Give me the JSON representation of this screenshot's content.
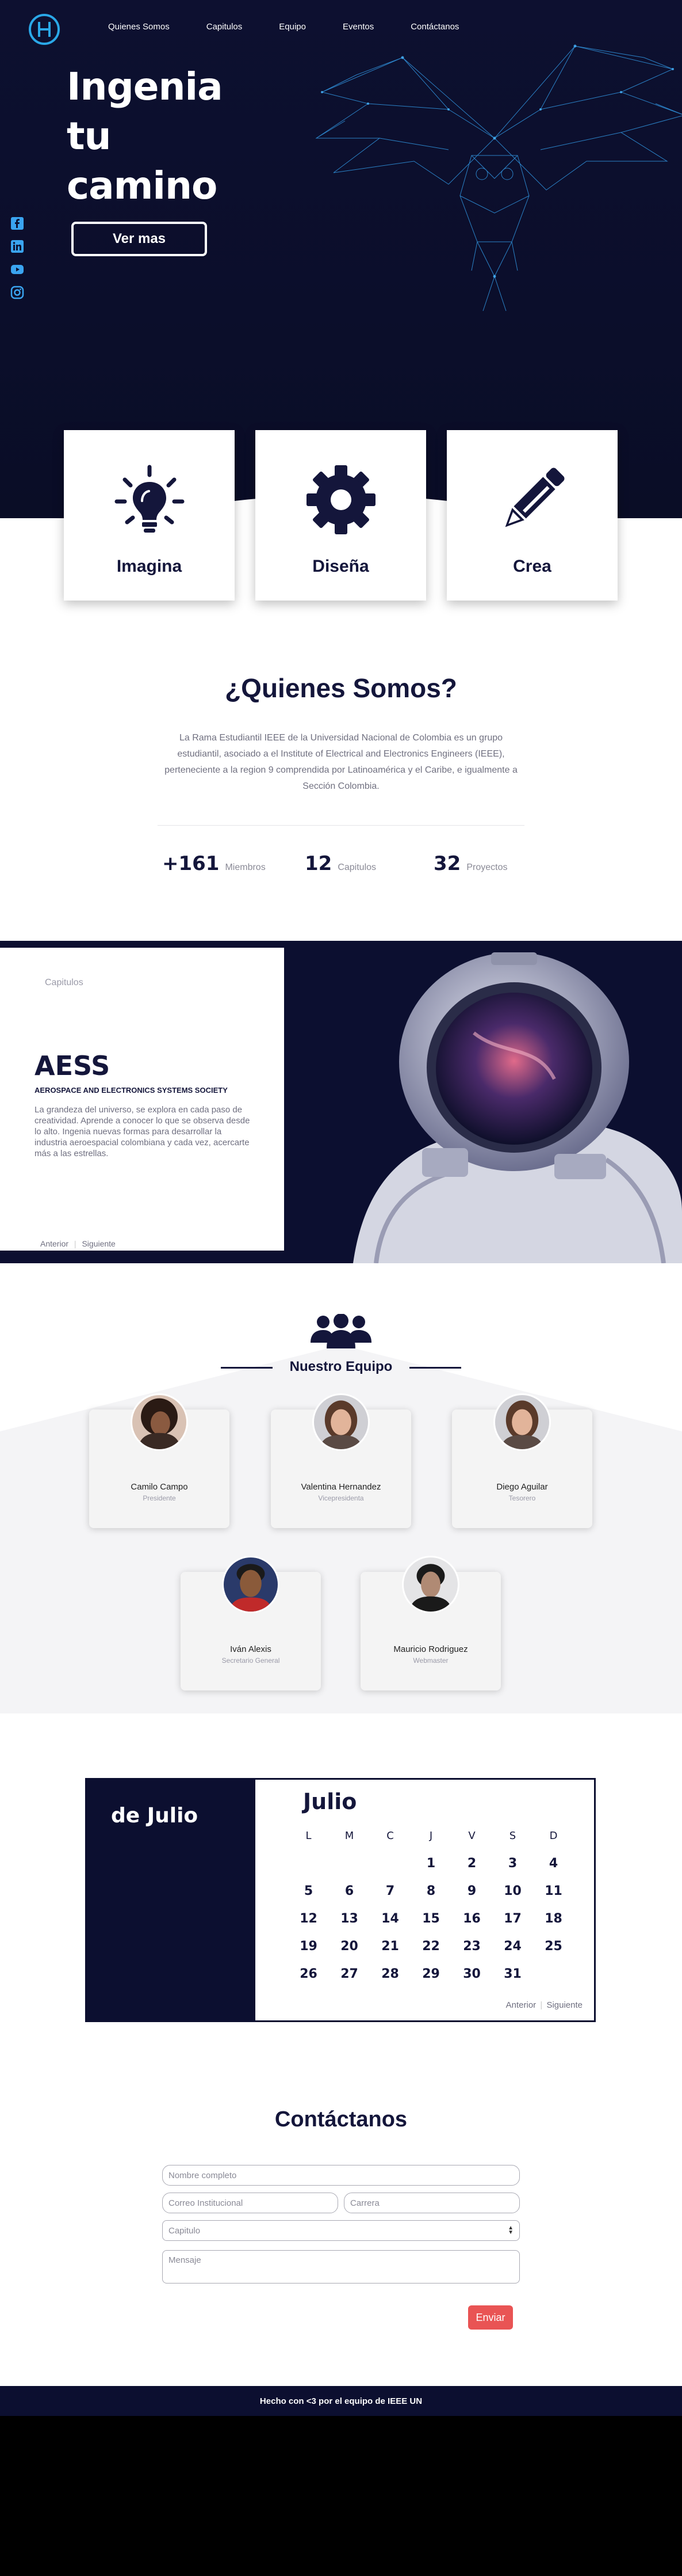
{
  "nav": {
    "items": [
      "Quienes Somos",
      "Capitulos",
      "Equipo",
      "Eventos",
      "Contáctanos"
    ]
  },
  "hero": {
    "title_lines": [
      "Ingenia",
      "tu",
      "camino"
    ],
    "button": "Ver mas"
  },
  "social": [
    "facebook-icon",
    "linkedin-icon",
    "youtube-icon",
    "instagram-icon"
  ],
  "cards": [
    {
      "label": "Imagina",
      "icon": "lightbulb-icon"
    },
    {
      "label": "Diseña",
      "icon": "gear-icon"
    },
    {
      "label": "Crea",
      "icon": "pencil-icon"
    }
  ],
  "about": {
    "title": "¿Quienes Somos?",
    "text": "La Rama Estudiantil IEEE de la Universidad Nacional de Colombia es un grupo estudiantil, asociado a el Institute of Electrical and Electronics Engineers (IEEE), perteneciente a la region 9 comprendida por Latinoamérica y el Caribe, e igualmente a Sección Colombia.",
    "stats": [
      {
        "number": "+161",
        "label": "Miembros"
      },
      {
        "number": "12",
        "label": "Capitulos"
      },
      {
        "number": "32",
        "label": "Proyectos"
      }
    ]
  },
  "chapters": {
    "label": "Capitulos",
    "name": "AESS",
    "subtitle": "AEROSPACE AND ELECTRONICS SYSTEMS SOCIETY",
    "description": "La grandeza del universo, se explora en cada paso de creatividad. Aprende a conocer lo que se observa desde lo alto. Ingenia nuevas formas para desarrollar la industria aeroespacial colombiana y cada vez, acercarte más a las estrellas.",
    "prev": "Anterior",
    "next": "Siguiente"
  },
  "team": {
    "title": "Nuestro Equipo",
    "members": [
      {
        "name": "Camilo Campo",
        "role": "Presidente"
      },
      {
        "name": "Valentina Hernandez",
        "role": "Vicepresidenta"
      },
      {
        "name": "Diego Aguilar",
        "role": "Tesorero"
      },
      {
        "name": "Iván Alexis",
        "role": "Secretario General"
      },
      {
        "name": "Mauricio Rodriguez",
        "role": "Webmaster"
      }
    ]
  },
  "calendar": {
    "day_label": "de Julio",
    "month": "Julio",
    "weekdays": [
      "L",
      "M",
      "C",
      "J",
      "V",
      "S",
      "D"
    ],
    "days": [
      "",
      "",
      "",
      "1",
      "2",
      "3",
      "4",
      "5",
      "6",
      "7",
      "8",
      "9",
      "10",
      "11",
      "12",
      "13",
      "14",
      "15",
      "16",
      "17",
      "18",
      "19",
      "20",
      "21",
      "22",
      "23",
      "24",
      "25",
      "26",
      "27",
      "28",
      "29",
      "30",
      "31",
      ""
    ],
    "prev": "Anterior",
    "next": "Siguiente"
  },
  "contact": {
    "title": "Contáctanos",
    "name_placeholder": "Nombre completo",
    "email_placeholder": "Correo Institucional",
    "career_placeholder": "Carrera",
    "chapter_placeholder": "Capitulo",
    "message_placeholder": "Mensaje",
    "send": "Enviar"
  },
  "footer": {
    "text": "Hecho con <3 por el equipo de IEEE UN"
  },
  "colors": {
    "navy": "#0c0f30",
    "accent": "#2aa8e8",
    "send": "#e95454"
  }
}
